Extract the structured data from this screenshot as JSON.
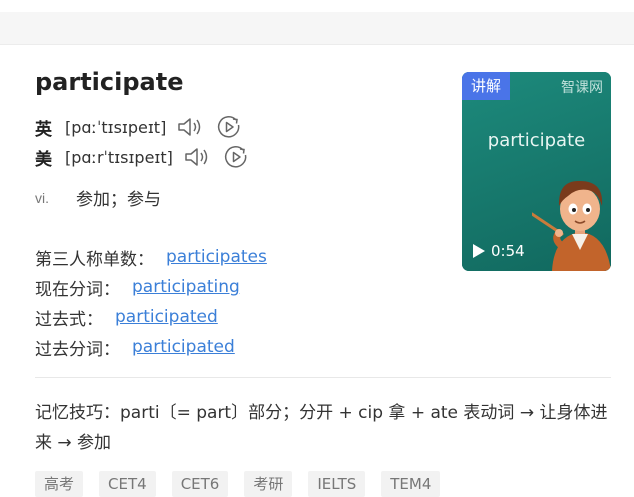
{
  "word": "participate",
  "pronunciations": [
    {
      "flag": "英",
      "phonetic": "[pɑːˈtɪsɪpeɪt]"
    },
    {
      "flag": "美",
      "phonetic": "[pɑːrˈtɪsɪpeɪt]"
    }
  ],
  "definition": {
    "pos": "vi.",
    "text": "参加；参与"
  },
  "forms": [
    {
      "label": "第三人称单数：",
      "value": "participates"
    },
    {
      "label": "现在分词：",
      "value": "participating"
    },
    {
      "label": "过去式：",
      "value": "participated"
    },
    {
      "label": "过去分词：",
      "value": "participated"
    }
  ],
  "video": {
    "tag": "讲解",
    "brand": "智课网",
    "word": "participate",
    "duration": "0:54"
  },
  "memo": "记忆技巧：parti〔= part〕部分；分开 + cip 拿 + ate 表动词 → 让身体进来 → 参加",
  "exam_tags": [
    "高考",
    "CET4",
    "CET6",
    "考研",
    "IELTS",
    "TEM4"
  ],
  "colors": {
    "link": "#3b7fd8",
    "video_bg": "#14776b",
    "tag_bg": "#4a74e8"
  }
}
